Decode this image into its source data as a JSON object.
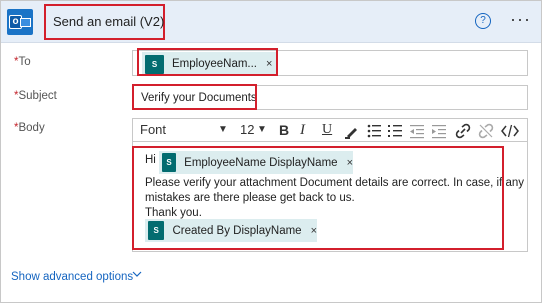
{
  "header": {
    "title": "Send an email (V2)",
    "help_glyph": "?",
    "more_glyph": "···",
    "app_icon": "outlook-icon"
  },
  "fields": {
    "to": {
      "required_mark": "*",
      "label": "To",
      "token": "EmployeeNam...",
      "token_icon": "sharepoint-icon",
      "remove_glyph": "×"
    },
    "subject": {
      "required_mark": "*",
      "label": "Subject",
      "value": "Verify your Documents"
    },
    "body": {
      "required_mark": "*",
      "label": "Body",
      "toolbar": {
        "font": "Font",
        "size": "12",
        "bold": "B",
        "italic": "I",
        "underline": "U"
      },
      "greeting": "Hi",
      "token1": "EmployeeName DisplayName",
      "line1": "Please verify your attachment Document details are correct. In case, if any",
      "line2": "mistakes are there please get back to us.",
      "line3": "Thank you.",
      "token2": "Created By DisplayName",
      "remove_glyph": "×",
      "sp_glyph": "S"
    }
  },
  "advanced": {
    "label": "Show advanced options"
  },
  "colors": {
    "accent": "#1565c0",
    "highlight_box": "#d31f2c",
    "token_bg": "#dcedef",
    "sharepoint": "#036c70",
    "header_bg": "#e6eef8"
  }
}
